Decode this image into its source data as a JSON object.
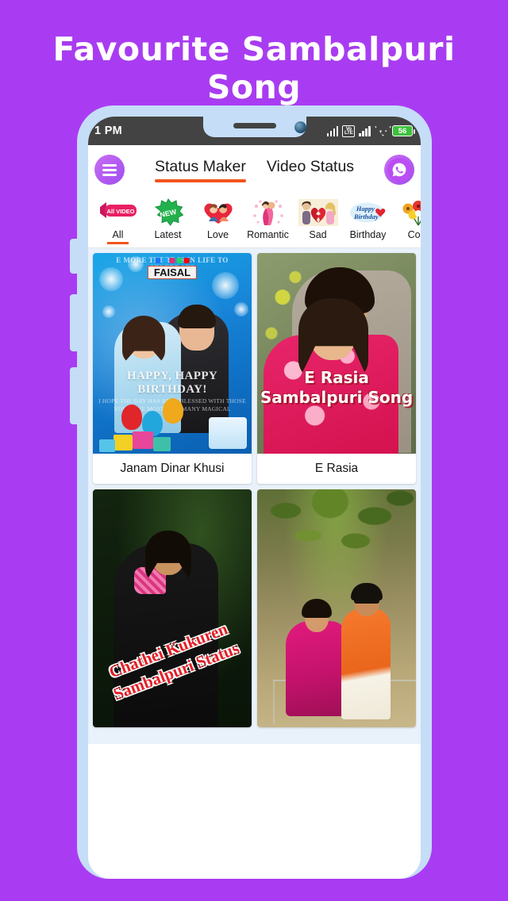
{
  "promo": {
    "headline": "Favourite Sambalpuri Song",
    "background_color": "#a93cf2",
    "phone_frame_color": "#c5ddf7"
  },
  "status_bar": {
    "time": "1 PM",
    "volte_label_top": "Vo",
    "volte_label_bottom": "LTE",
    "battery_percent": "56",
    "battery_color": "#3ec13e",
    "icons": [
      "signal-bars-icon",
      "volte-icon",
      "signal-bars-icon",
      "wifi-icon",
      "battery-icon"
    ]
  },
  "app_header": {
    "menu_icon": "hamburger-menu-icon",
    "share_icon": "whatsapp-icon",
    "accent_color": "#f1541d",
    "tabs": [
      {
        "label": "Status Maker",
        "active": true
      },
      {
        "label": "Video Status",
        "active": false
      }
    ]
  },
  "categories": [
    {
      "label": "All",
      "icon": "all-video-ribbon-icon",
      "active": true,
      "badge_text": "All VIDEO"
    },
    {
      "label": "Latest",
      "icon": "new-starburst-icon",
      "active": false,
      "badge_text": "NEW"
    },
    {
      "label": "Love",
      "icon": "love-couple-heart-icon",
      "active": false
    },
    {
      "label": "Romantic",
      "icon": "romantic-couple-icon",
      "active": false
    },
    {
      "label": "Sad",
      "icon": "broken-heart-icon",
      "active": false
    },
    {
      "label": "Birthday",
      "icon": "happy-birthday-icon",
      "active": false,
      "badge_text": "Happy Birthday"
    },
    {
      "label": "Cool",
      "icon": "flower-bouquet-icon",
      "active": false
    }
  ],
  "cards": [
    {
      "title": "Janam Dinar Khusi",
      "overlay_top_text": "E MORE THERE IS IN LIFE TO CELEBRATE",
      "overlay_brand": "FAISAL",
      "overlay_headline": "HAPPY, HAPPY BIRTHDAY!",
      "overlay_subtext": "I HOPE THE DAY HAS BEEN BLESSED WITH THOSE YOU LOVE MOST, AND MANY MAGICAL",
      "theme": "birthday-blue"
    },
    {
      "title": "E Rasia",
      "overlay_headline": "E Rasia",
      "overlay_subhead": "Sambalpuri Song",
      "theme": "outdoor-yellow-flowers"
    },
    {
      "title": "",
      "overlay_headline": "Chathei Kukuren",
      "overlay_subhead": "Sambalpuri Status",
      "theme": "dark-jungle"
    },
    {
      "title": "",
      "overlay_headline": "",
      "theme": "village-outdoor"
    }
  ]
}
